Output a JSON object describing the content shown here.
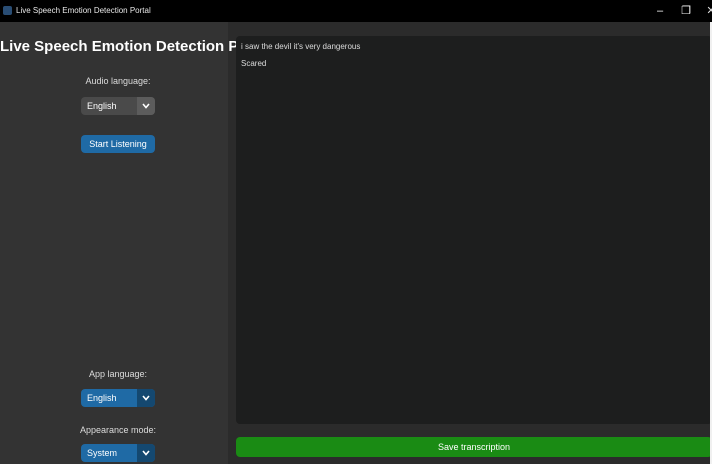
{
  "window": {
    "title": "Live Speech Emotion Detection Portal",
    "minimize_glyph": "–",
    "maximize_glyph": "❐",
    "close_glyph": "✕"
  },
  "sidebar": {
    "title": "Live Speech Emotion Detection Portal",
    "audio_language_label": "Audio language:",
    "audio_language_value": "English",
    "start_button_label": "Start Listening",
    "app_language_label": "App language:",
    "app_language_value": "English",
    "appearance_label": "Appearance mode:",
    "appearance_value": "System",
    "dropdown_arrow_icon": "chevron-down-icon"
  },
  "main": {
    "transcription": "i saw the devil it's very dangerous",
    "emotion": "Scared",
    "save_button_label": "Save transcription"
  },
  "colors": {
    "accent_blue": "#1f6aa5",
    "save_green": "#1a8b14",
    "sidebar_bg": "#333333",
    "textbox_bg": "#1d1e1e"
  }
}
